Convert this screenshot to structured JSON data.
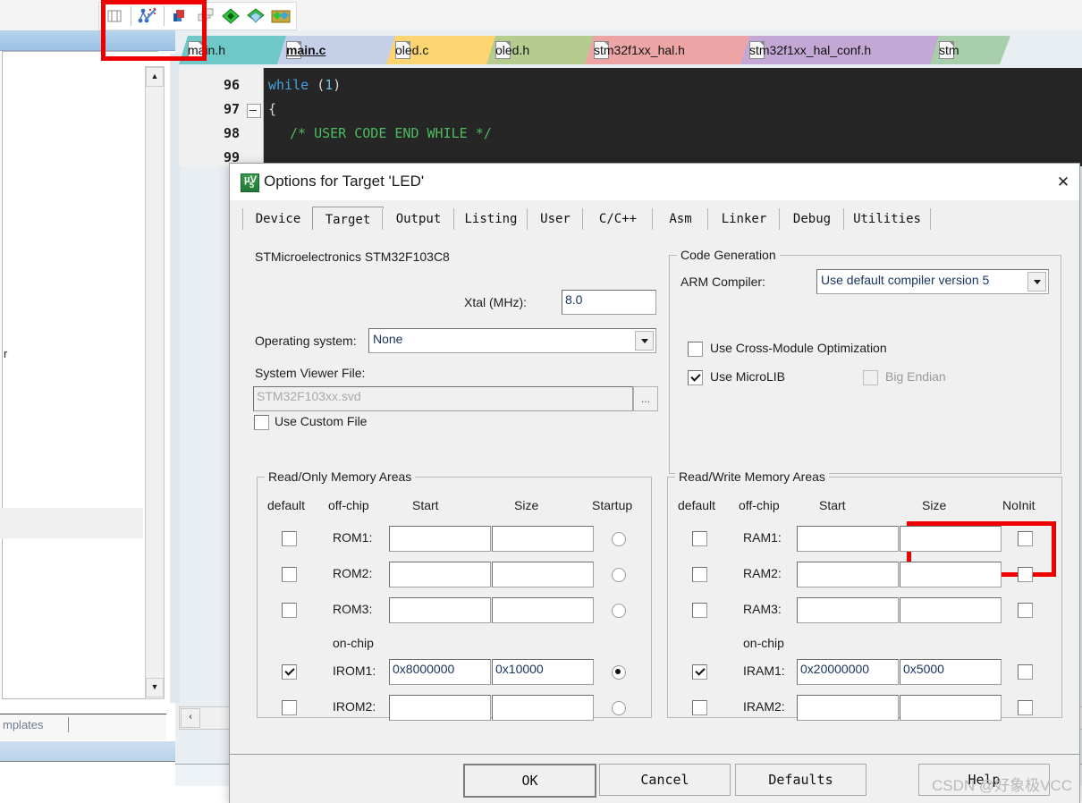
{
  "ide": {
    "toolbar_icons": [
      "panel-toggle-icon",
      "config-wizard-icon",
      "build-icon",
      "batch-build-icon",
      "target-options-icon",
      "manage-components-icon",
      "multi-project-icon"
    ],
    "left_panel": {
      "pin_glyph": "┐",
      "close_glyph": "✕",
      "text_fragment": "r",
      "templates_label": "mplates",
      "scroll_up_glyph": "▲",
      "scroll_down_glyph": "▼"
    },
    "file_tabs": [
      {
        "label": "main.h",
        "color": "#6ec8c8",
        "active": false
      },
      {
        "label": "main.c",
        "color": "#c5cfe8",
        "active": true
      },
      {
        "label": "oled.c",
        "color": "#fcd571",
        "active": false
      },
      {
        "label": "oled.h",
        "color": "#b6cb8e",
        "active": false
      },
      {
        "label": "stm32f1xx_hal.h",
        "color": "#eda4a4",
        "active": false
      },
      {
        "label": "stm32f1xx_hal_conf.h",
        "color": "#c3a8d6",
        "active": false
      },
      {
        "label": "stm",
        "color": "#a9ceab",
        "active": false
      }
    ],
    "code": {
      "lines": [
        {
          "no": "96",
          "indent": 0,
          "tokens": [
            {
              "t": "while",
              "c": "kw"
            },
            {
              "t": " ",
              "c": "pn"
            },
            {
              "t": "(",
              "c": "pn"
            },
            {
              "t": "1",
              "c": "num"
            },
            {
              "t": ")",
              "c": "pn"
            }
          ]
        },
        {
          "no": "97",
          "indent": 0,
          "tokens": [
            {
              "t": "{",
              "c": "pn"
            }
          ]
        },
        {
          "no": "98",
          "indent": 1,
          "tokens": [
            {
              "t": "/* USER CODE END WHILE */",
              "c": "cmt"
            }
          ]
        },
        {
          "no": "99",
          "indent": 0,
          "tokens": []
        }
      ]
    },
    "hscroll_left_glyph": "‹"
  },
  "dialog": {
    "title": "Options for Target 'LED'",
    "close_glyph": "✕",
    "tabs": [
      {
        "label": "Device",
        "selected": false
      },
      {
        "label": "Target",
        "selected": true
      },
      {
        "label": "Output",
        "selected": false
      },
      {
        "label": "Listing",
        "selected": false
      },
      {
        "label": "User",
        "selected": false
      },
      {
        "label": "C/C++",
        "selected": false
      },
      {
        "label": "Asm",
        "selected": false
      },
      {
        "label": "Linker",
        "selected": false
      },
      {
        "label": "Debug",
        "selected": false
      },
      {
        "label": "Utilities",
        "selected": false
      }
    ],
    "device_name": "STMicroelectronics STM32F103C8",
    "xtal": {
      "label": "Xtal (MHz):",
      "value": "8.0"
    },
    "operating_system": {
      "label": "Operating system:",
      "value": "None"
    },
    "system_viewer": {
      "label": "System Viewer File:",
      "value": "STM32F103xx.svd",
      "browse_label": "..."
    },
    "use_custom_file": {
      "label": "Use Custom File",
      "checked": false
    },
    "code_generation": {
      "title": "Code Generation",
      "arm_compiler_label": "ARM Compiler:",
      "arm_compiler_value": "Use default compiler version 5",
      "cross_module": {
        "label": "Use Cross-Module Optimization",
        "checked": false
      },
      "microlib": {
        "label": "Use MicroLIB",
        "checked": true
      },
      "big_endian": {
        "label": "Big Endian",
        "checked": false,
        "disabled": true
      }
    },
    "ro_memory": {
      "title": "Read/Only Memory Areas",
      "headers": [
        "default",
        "off-chip",
        "Start",
        "Size",
        "Startup"
      ],
      "onchip_label": "on-chip",
      "offchip_rows": [
        {
          "name": "ROM1:",
          "default": false,
          "start": "",
          "size": "",
          "startup": false
        },
        {
          "name": "ROM2:",
          "default": false,
          "start": "",
          "size": "",
          "startup": false
        },
        {
          "name": "ROM3:",
          "default": false,
          "start": "",
          "size": "",
          "startup": false
        }
      ],
      "onchip_rows": [
        {
          "name": "IROM1:",
          "default": true,
          "start": "0x8000000",
          "size": "0x10000",
          "startup": true
        },
        {
          "name": "IROM2:",
          "default": false,
          "start": "",
          "size": "",
          "startup": false
        }
      ]
    },
    "rw_memory": {
      "title": "Read/Write Memory Areas",
      "headers": [
        "default",
        "off-chip",
        "Start",
        "Size",
        "NoInit"
      ],
      "onchip_label": "on-chip",
      "offchip_rows": [
        {
          "name": "RAM1:",
          "default": false,
          "start": "",
          "size": "",
          "noinit": false
        },
        {
          "name": "RAM2:",
          "default": false,
          "start": "",
          "size": "",
          "noinit": false
        },
        {
          "name": "RAM3:",
          "default": false,
          "start": "",
          "size": "",
          "noinit": false
        }
      ],
      "onchip_rows": [
        {
          "name": "IRAM1:",
          "default": true,
          "start": "0x20000000",
          "size": "0x5000",
          "noinit": false
        },
        {
          "name": "IRAM2:",
          "default": false,
          "start": "",
          "size": "",
          "noinit": false
        }
      ]
    },
    "buttons": {
      "ok": "OK",
      "cancel": "Cancel",
      "defaults": "Defaults",
      "help": "Help"
    }
  },
  "annotations": {
    "highlight_color": "#ee0000",
    "microlib_highlight": "Use MicroLIB",
    "toolbar_highlight": "config-wizard-icon"
  },
  "watermark": "CSDN @好象极VCC"
}
